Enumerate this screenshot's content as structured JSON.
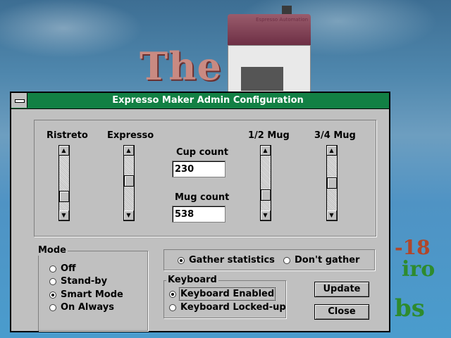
{
  "background": {
    "word": "The",
    "fragments": [
      "-18",
      "iro",
      "bs"
    ],
    "machine_logo": "Espresso Automation"
  },
  "window": {
    "title": "Expresso Maker Admin Configuration",
    "title_color": "#128044"
  },
  "strength": {
    "ristreto": {
      "label": "Ristreto",
      "level": 0.8
    },
    "expresso": {
      "label": "Expresso",
      "level": 0.45
    },
    "half_mug": {
      "label": "1/2 Mug",
      "level": 0.78
    },
    "three_quarter_mug": {
      "label": "3/4 Mug",
      "level": 0.5
    }
  },
  "counts": {
    "cup_label": "Cup count",
    "cup_value": "230",
    "mug_label": "Mug count",
    "mug_value": "538"
  },
  "mode": {
    "label": "Mode",
    "options": [
      "Off",
      "Stand-by",
      "Smart Mode",
      "On Always"
    ],
    "selected": "Smart Mode"
  },
  "statistics": {
    "options": [
      "Gather statistics",
      "Don't gather"
    ],
    "selected": "Gather statistics"
  },
  "keyboard": {
    "label": "Keyboard",
    "options": [
      "Keyboard Enabled",
      "Keyboard Locked-up"
    ],
    "selected": "Keyboard Enabled"
  },
  "buttons": {
    "update": "Update",
    "close": "Close"
  }
}
